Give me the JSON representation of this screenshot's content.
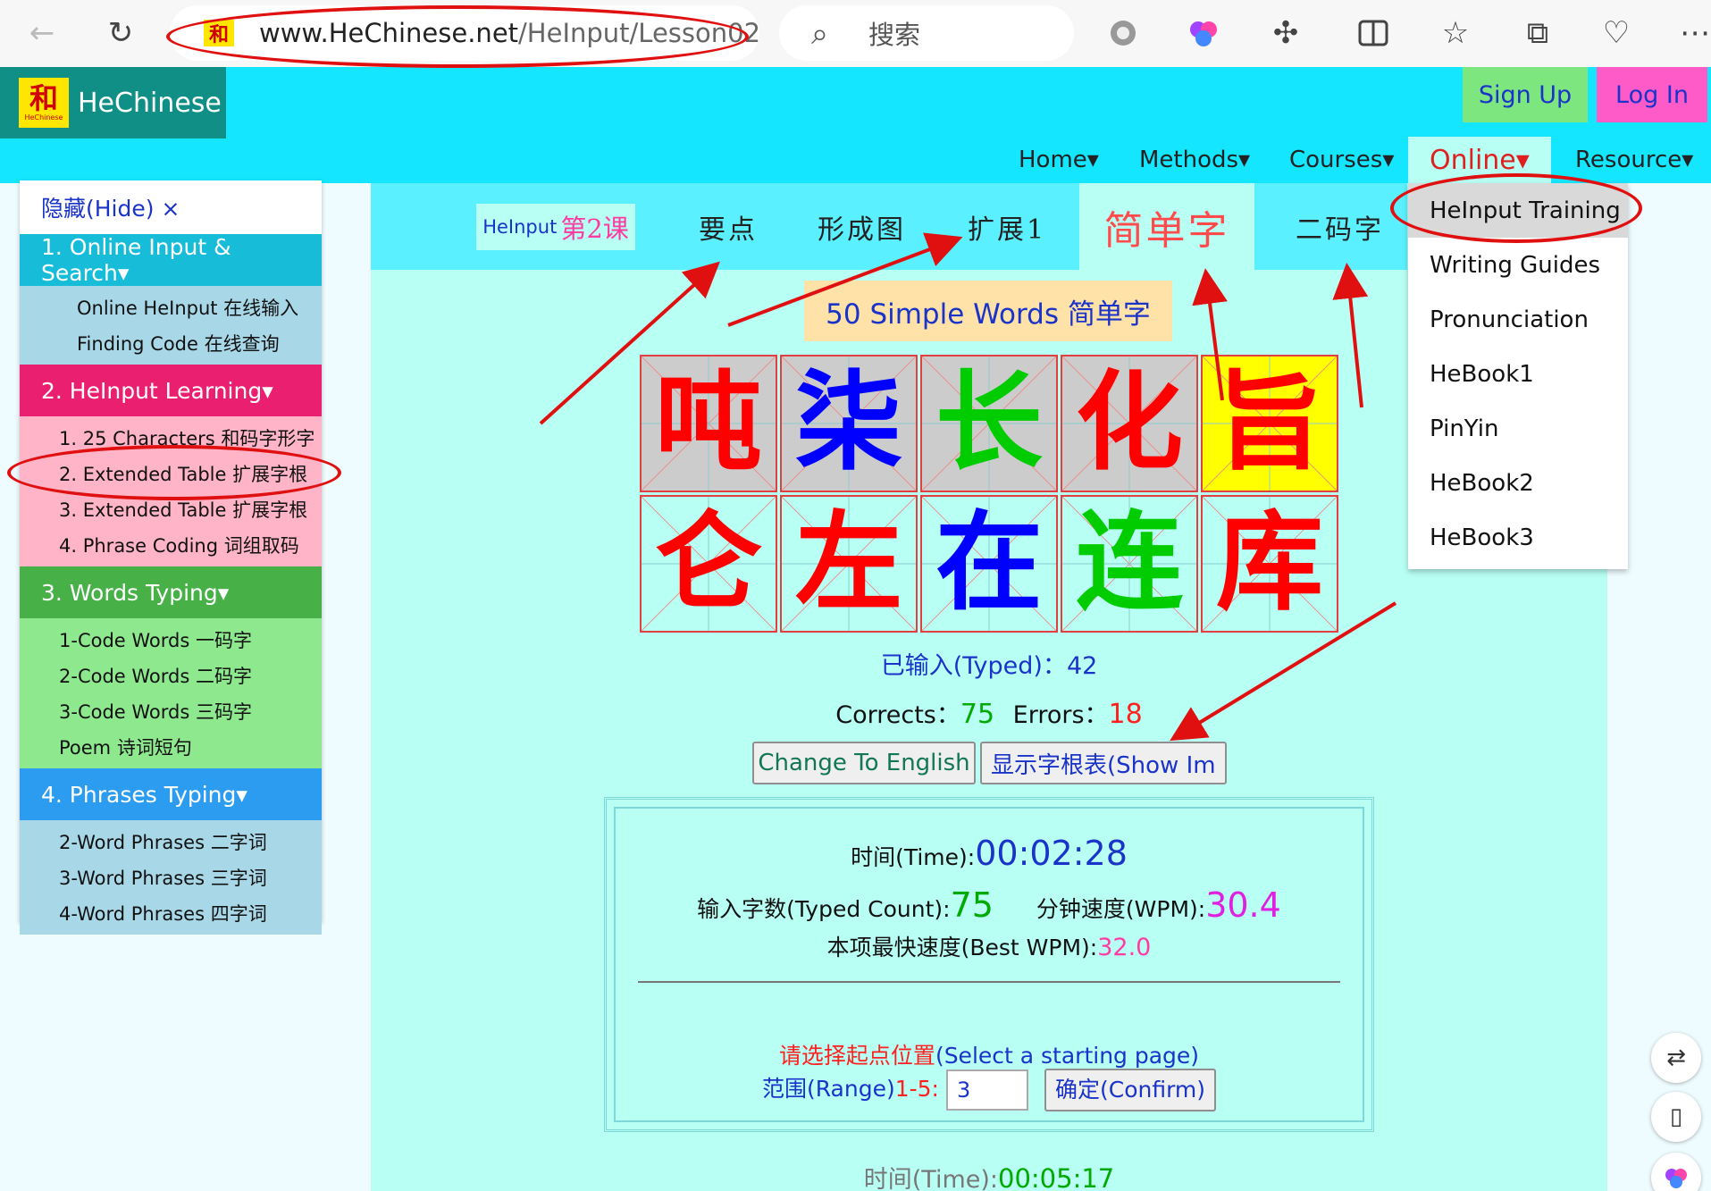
{
  "browser": {
    "url_host": "www.HeChinese.net",
    "url_path": "/HeInput/Lesson02",
    "search_placeholder": "搜索"
  },
  "site": {
    "logo_char": "和",
    "logo_small": "HeChinese",
    "name": "HeChinese",
    "signup": "Sign Up",
    "login": "Log In",
    "nav": [
      "Home▾",
      "Methods▾",
      "Courses▾",
      "Online▾",
      "Resource▾"
    ]
  },
  "dropdown": {
    "items": [
      "HeInput Training",
      "Writing Guides",
      "Pronunciation",
      "HeBook1",
      "PinYin",
      "HeBook2",
      "HeBook3"
    ]
  },
  "sidebar": {
    "hide": "隐藏(Hide) ×",
    "groups": [
      {
        "title": "1. Online Input & Search▾",
        "color": "#17bcd8",
        "sub_bg": "#a8d8e8",
        "items": [
          "Online HeInput 在线输入",
          "Finding Code 在线查询"
        ]
      },
      {
        "title": "2. HeInput Learning▾",
        "color": "#eb1f6f",
        "sub_bg": "#ffb4c8",
        "items": [
          "1. 25 Characters 和码字形字",
          "2. Extended Table 扩展字根",
          "3. Extended Table 扩展字根",
          "4. Phrase Coding 词组取码"
        ]
      },
      {
        "title": "3. Words Typing▾",
        "color": "#47b047",
        "sub_bg": "#8ee88e",
        "items": [
          "1-Code Words 一码字",
          "2-Code Words 二码字",
          "3-Code Words 三码字",
          "Poem 诗词短句"
        ]
      },
      {
        "title": "4. Phrases Typing▾",
        "color": "#2b9cf0",
        "sub_bg": "#a8d8e8",
        "items": [
          "2-Word Phrases 二字词",
          "3-Word Phrases 三字词",
          "4-Word Phrases 四字词"
        ]
      }
    ]
  },
  "lesson": {
    "label": "HeInput",
    "num": "第2课",
    "tabs": [
      "要点",
      "形成图",
      "扩展1",
      "简单字",
      "二码字"
    ]
  },
  "words_title": "50 Simple Words  简单字",
  "chars": [
    {
      "ch": "吨",
      "color": "#ff0000"
    },
    {
      "ch": "柒",
      "color": "#0000ff"
    },
    {
      "ch": "长",
      "color": "#00cc00"
    },
    {
      "ch": "化",
      "color": "#ff0000"
    },
    {
      "ch": "旨",
      "color": "#ff0000"
    },
    {
      "ch": "仑",
      "color": "#ff0000"
    },
    {
      "ch": "左",
      "color": "#ff0000"
    },
    {
      "ch": "在",
      "color": "#0000ff"
    },
    {
      "ch": "连",
      "color": "#00cc00"
    },
    {
      "ch": "库",
      "color": "#ff0000"
    }
  ],
  "stats": {
    "typed_label": "已输入(Typed)：",
    "typed_value": "42",
    "corrects_label": "Corrects：",
    "corrects_value": "75",
    "errors_label": "Errors：",
    "errors_value": "18"
  },
  "buttons": {
    "change_lang": "Change To English",
    "show_table": "显示字根表(Show Im"
  },
  "result": {
    "time_label": "时间(Time):",
    "time_value": "00:02:28",
    "count_label": "输入字数(Typed Count):",
    "count_value": "75",
    "wpm_label": "分钟速度(WPM):",
    "wpm_value": "30.4",
    "best_label": "本项最快速度(Best WPM):",
    "best_value": "32.0",
    "select_label_cn": "请选择起点位置",
    "select_label_en": "(Select a starting page)",
    "range_label": "范围(Range)",
    "range_value": "1-5:",
    "range_input": "3",
    "confirm": "确定(Confirm)"
  },
  "footer_line": {
    "time_label": "时间(Time):",
    "time_value": "00:05:17"
  }
}
